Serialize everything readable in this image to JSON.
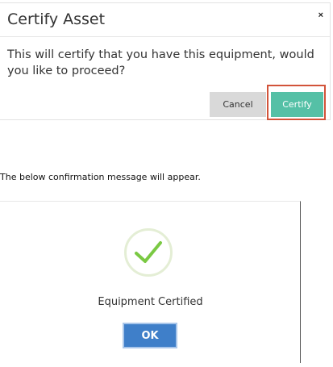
{
  "dialog": {
    "title": "Certify Asset",
    "close_glyph": "×",
    "message": "This will certify that you have this equipment, would you like to proceed?",
    "cancel_label": "Cancel",
    "certify_label": "Certify"
  },
  "note": "The below confirmation message will appear.",
  "confirmation": {
    "icon": "checkmark-icon",
    "message": "Equipment Certified",
    "ok_label": "OK"
  },
  "colors": {
    "certify_button": "#55c0a6",
    "highlight_border": "#d2533a",
    "ok_button": "#3f7fc9",
    "check": "#7ac943"
  }
}
